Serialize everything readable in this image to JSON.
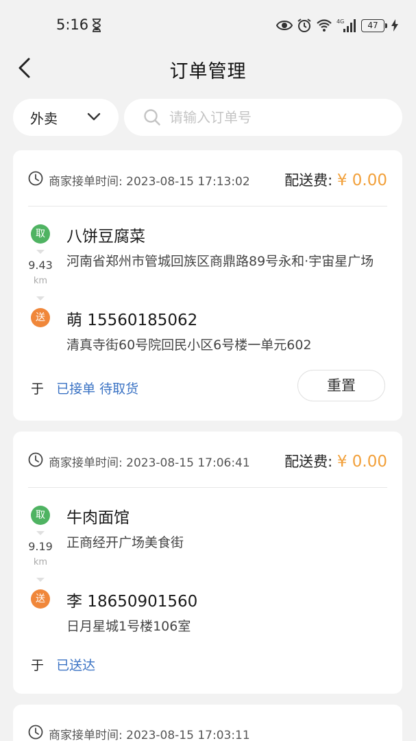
{
  "status_bar": {
    "time": "5:16",
    "battery": "47",
    "network": "4G"
  },
  "header": {
    "title": "订单管理"
  },
  "filter": {
    "type_selected": "外卖",
    "search_placeholder": "请输入订单号"
  },
  "orders": [
    {
      "accept_time_label": "商家接单时间:",
      "accept_time": "2023-08-15 17:13:02",
      "fee_label": "配送费:",
      "fee_amount": "¥ 0.00",
      "pickup_badge": "取",
      "shop_name": "八饼豆腐菜",
      "shop_address": "河南省郑州市管城回族区商鼎路89号永和·宇宙星广场",
      "distance": "9.43",
      "distance_unit": "km",
      "drop_badge": "送",
      "customer": "萌 15560185062",
      "customer_address": "清真寺街60号院回民小区6号楼一单元602",
      "by": "于",
      "status": "已接单 待取货",
      "action_label": "重置"
    },
    {
      "accept_time_label": "商家接单时间:",
      "accept_time": "2023-08-15 17:06:41",
      "fee_label": "配送费:",
      "fee_amount": "¥ 0.00",
      "pickup_badge": "取",
      "shop_name": "牛肉面馆",
      "shop_address": "正商经开广场美食街",
      "distance": "9.19",
      "distance_unit": "km",
      "drop_badge": "送",
      "customer": "李 18650901560",
      "customer_address": "日月星城1号楼106室",
      "by": "于",
      "status": "已送达"
    },
    {
      "accept_time_label": "商家接单时间:",
      "accept_time": "2023-08-15 17:03:11"
    }
  ],
  "colors": {
    "accent_blue": "#3b73c4",
    "fee_orange": "#f2a03a",
    "pickup_green": "#4fb362",
    "drop_orange": "#f0873a",
    "background": "#f2f2f2"
  }
}
